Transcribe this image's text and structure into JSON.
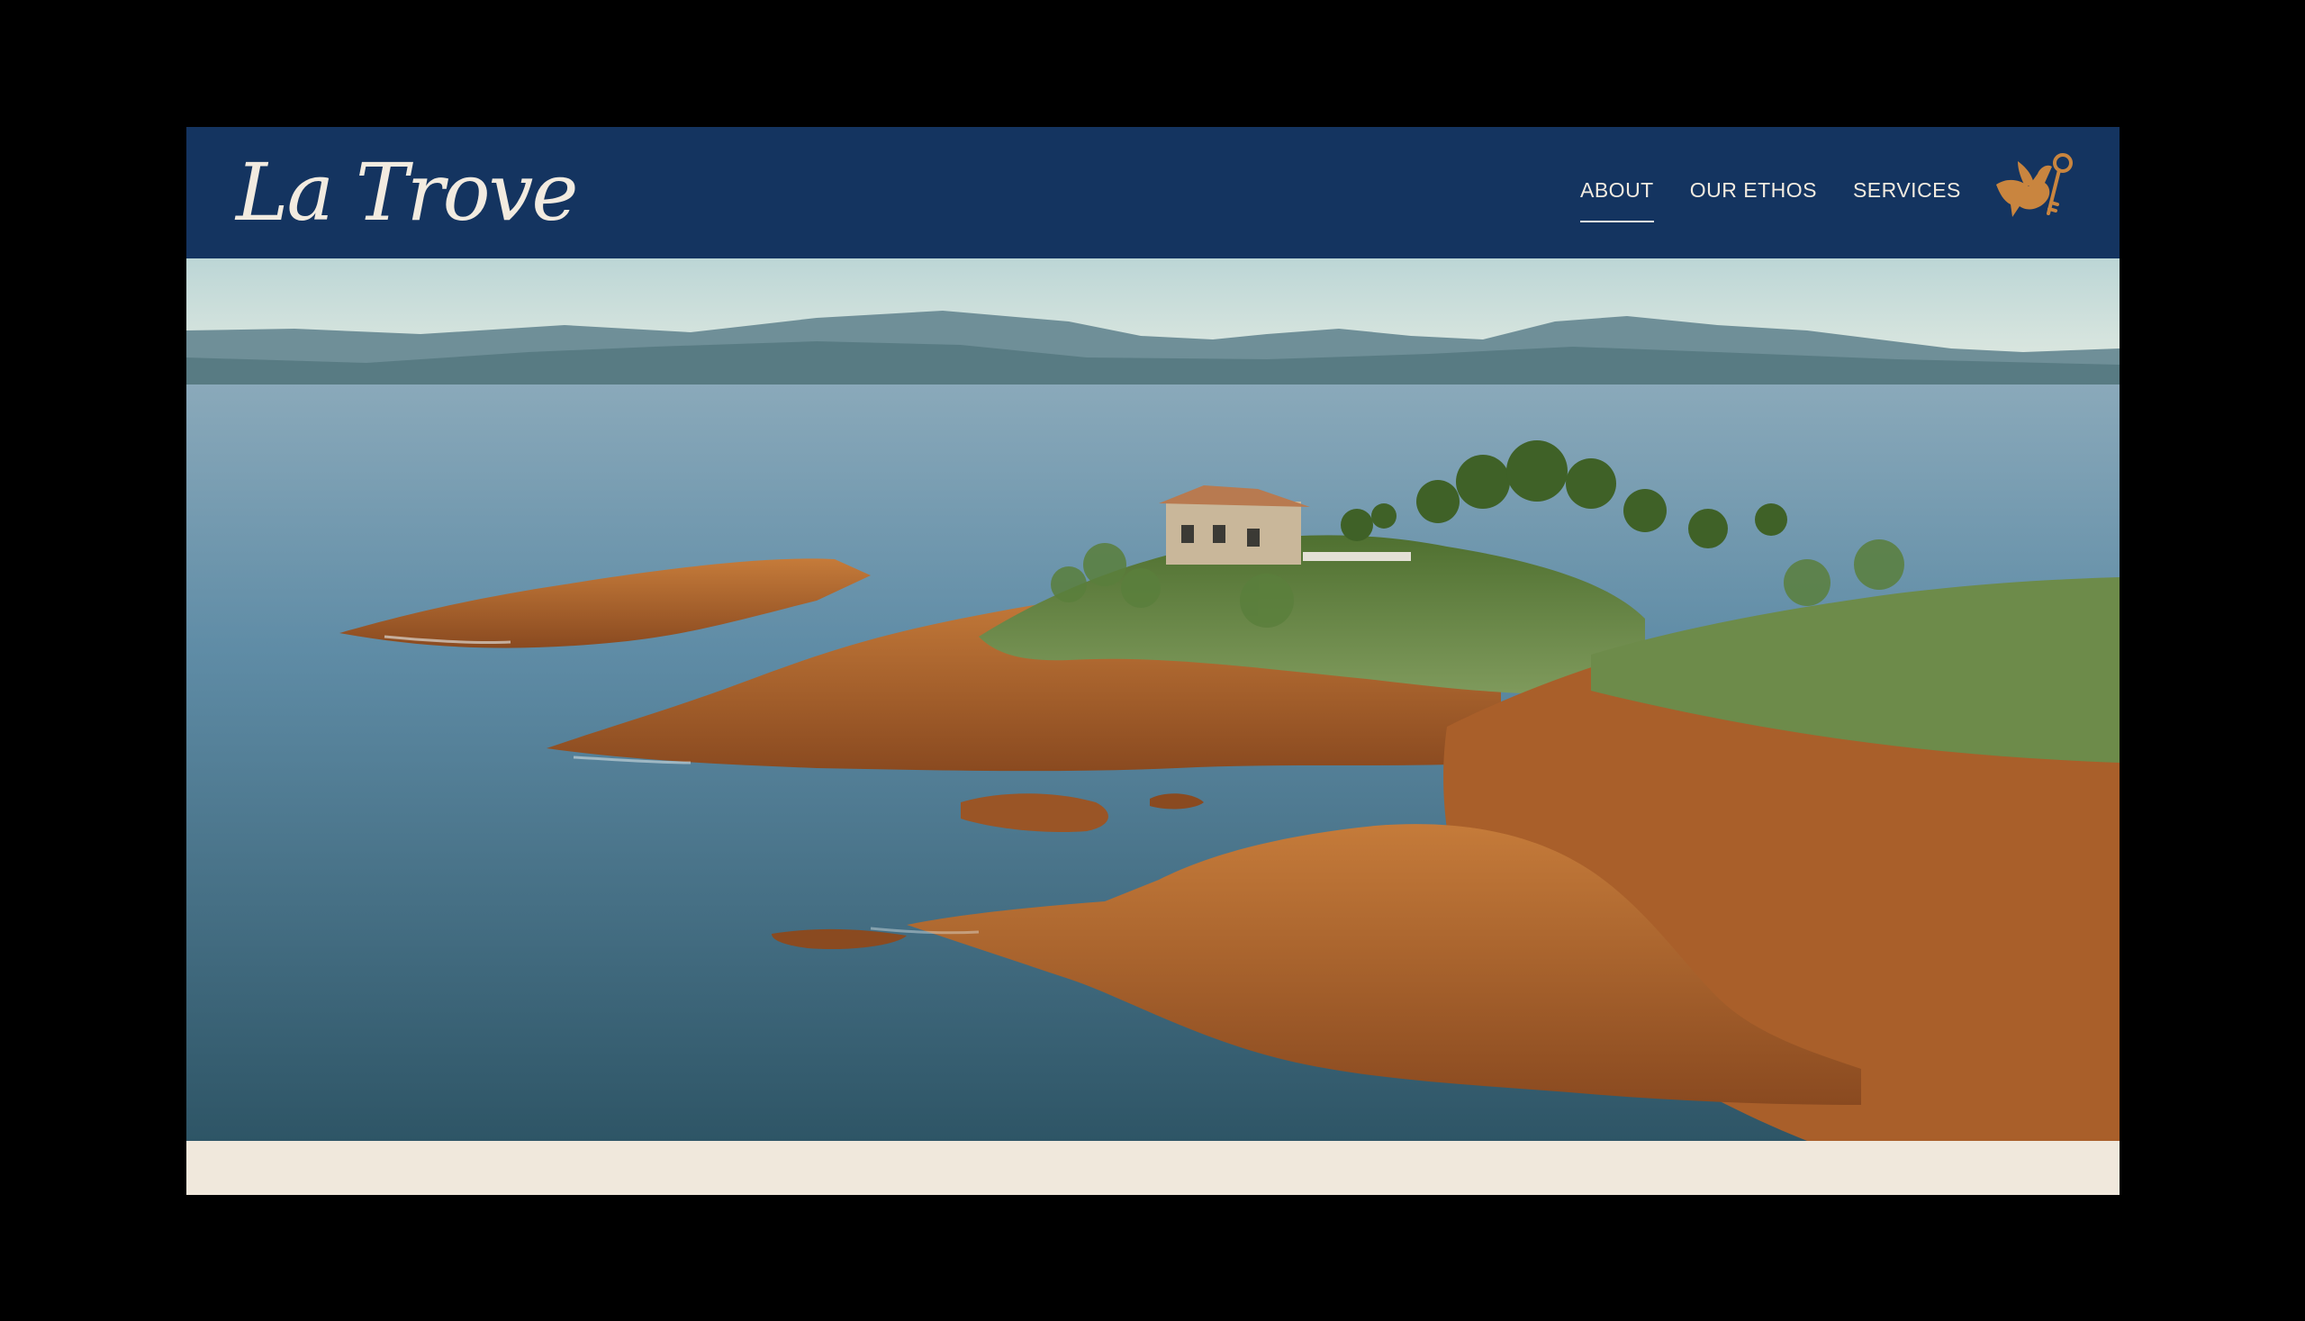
{
  "header": {
    "logo_text": "La Trove",
    "background": "#143460",
    "text_color": "#f2ebe0"
  },
  "nav": {
    "items": [
      {
        "label": "ABOUT",
        "active": true
      },
      {
        "label": "OUR ETHOS",
        "active": false
      },
      {
        "label": "SERVICES",
        "active": false
      }
    ]
  },
  "brand_mark": {
    "icon": "bird-with-key-icon",
    "color": "#c9853f"
  },
  "hero": {
    "icon": "coastal-landscape-image",
    "colors": {
      "sky": "#cfe0de",
      "sea": "#4e7f98",
      "rock": "#b4662e",
      "vegetation": "#5c7f3a"
    }
  },
  "page": {
    "background": "#000000",
    "footer_strip": "#f0e8dc"
  }
}
